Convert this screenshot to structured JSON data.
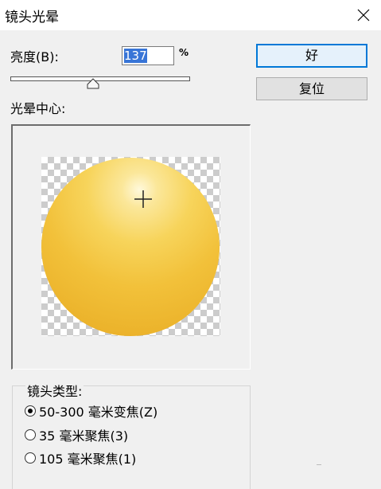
{
  "window": {
    "title": "镜头光晕",
    "close_icon": "close-icon"
  },
  "brightness": {
    "label": "亮度(B):",
    "value": "137",
    "unit": "%",
    "slider_fraction": 0.46
  },
  "buttons": {
    "ok_label": "好",
    "reset_label": "复位"
  },
  "flare_center": {
    "label": "光晕中心:",
    "crosshair_icon": "crosshair-icon",
    "sphere_color": "#f2c13a"
  },
  "lens_type": {
    "label": "镜头类型:",
    "options": [
      {
        "label": "50-300 毫米变焦(Z)",
        "checked": true
      },
      {
        "label": "35 毫米聚焦(3)",
        "checked": false
      },
      {
        "label": "105 毫米聚焦(1)",
        "checked": false
      }
    ]
  },
  "colors": {
    "dialog_bg": "#f0f0f0",
    "focus_blue": "#0078d7",
    "selection_blue": "#3875d7"
  }
}
